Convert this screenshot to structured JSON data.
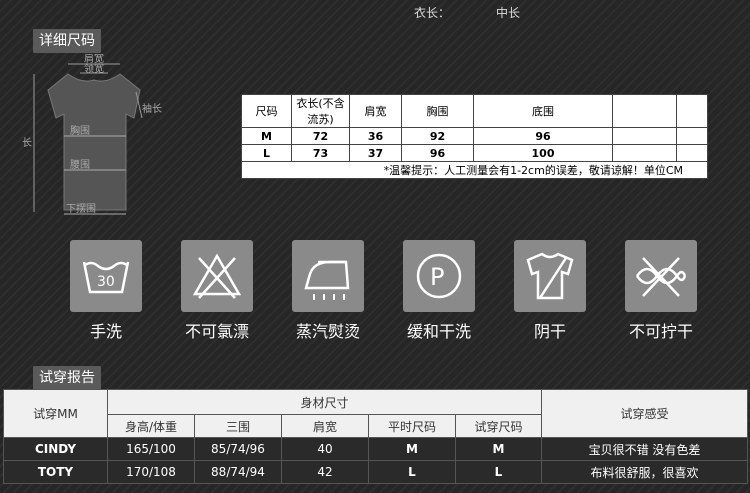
{
  "top": {
    "length_label": "衣长：",
    "length_value": "中长"
  },
  "detail_section": {
    "title": "详细尺码"
  },
  "diagram": {
    "shoulder": "肩宽",
    "collar": "领宽",
    "sleeve": "袖长",
    "length": "衣长",
    "chest": "胸围",
    "waist": "腰围",
    "hem": "下摆围"
  },
  "size_table": {
    "headers": [
      "尺码",
      "衣长(不含流苏)",
      "肩宽",
      "胸围",
      "底围"
    ],
    "rows": [
      [
        "M",
        "72",
        "36",
        "92",
        "96"
      ],
      [
        "L",
        "73",
        "37",
        "96",
        "100"
      ]
    ],
    "note": "*温馨提示：人工测量会有1-2cm的误差，敬请谅解！单位CM"
  },
  "care": [
    {
      "label": "手洗",
      "icon": "hand-wash-icon",
      "num": "30"
    },
    {
      "label": "不可氯漂",
      "icon": "no-bleach-icon"
    },
    {
      "label": "蒸汽熨烫",
      "icon": "steam-iron-icon"
    },
    {
      "label": "缓和干洗",
      "icon": "gentle-dry-clean-icon",
      "letter": "P"
    },
    {
      "label": "阴干",
      "icon": "shade-dry-icon"
    },
    {
      "label": "不可拧干",
      "icon": "no-wring-icon"
    }
  ],
  "report": {
    "title": "试穿报告",
    "header": {
      "mm": "试穿MM",
      "body_size": "身材尺寸",
      "feel": "试穿感受",
      "cols": [
        "身高/体重",
        "三围",
        "肩宽",
        "平时尺码",
        "试穿尺码"
      ]
    },
    "rows": [
      {
        "name": "CINDY",
        "hw": "165/100",
        "bwh": "85/74/96",
        "shoulder": "40",
        "usual": "M",
        "tried": "M",
        "feel": "宝贝很不错 没有色差"
      },
      {
        "name": "TOTY",
        "hw": "170/108",
        "bwh": "88/74/94",
        "shoulder": "42",
        "usual": "L",
        "tried": "L",
        "feel": "布料很舒服，很喜欢"
      }
    ]
  }
}
